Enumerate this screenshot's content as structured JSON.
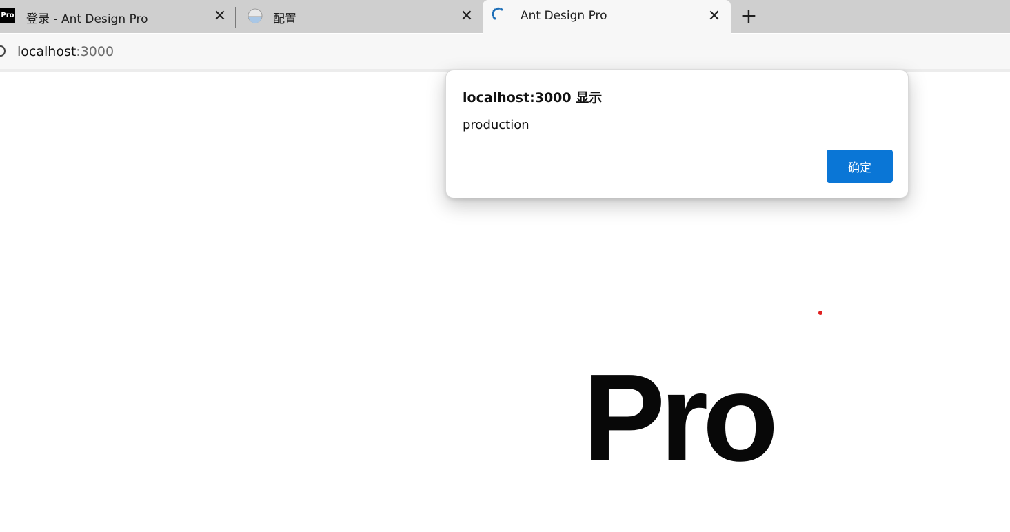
{
  "tabs": [
    {
      "title": "登录 - Ant Design Pro",
      "favicon": "pro-logo-icon",
      "favicon_text": "Pro",
      "active": false
    },
    {
      "title": "配置",
      "favicon": "globe-icon",
      "active": false
    },
    {
      "title": "Ant Design Pro",
      "favicon": "loading-spinner-icon",
      "active": true
    }
  ],
  "tab_close_glyph": "✕",
  "new_tab_glyph": "+",
  "address_bar": {
    "host": "localhost",
    "port": ":3000"
  },
  "dialog": {
    "title": "localhost:3000 显示",
    "message": "production",
    "ok_label": "确定"
  },
  "page": {
    "logo_text": "Pro"
  },
  "colors": {
    "accent": "#0a76d6",
    "dot": "#e02020"
  }
}
